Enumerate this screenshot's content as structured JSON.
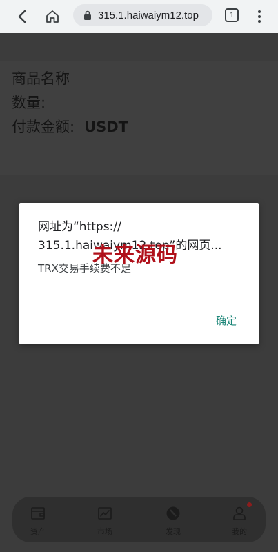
{
  "browser": {
    "url": "315.1.haiwaiym12.top",
    "tab_count": "1",
    "icons": [
      "back-arrow-icon",
      "home-icon",
      "lock-icon",
      "more-vert-icon"
    ]
  },
  "order": {
    "product_label": "商品名称",
    "quantity_label": "数量:",
    "payment_label": "付款金额:",
    "currency": "USDT"
  },
  "dialog": {
    "title_line1": "网址为“https://",
    "title_line2": "315.1.haiwaiym12.top”的网页...",
    "message": "TRX交易手续费不足",
    "ok_label": "确定",
    "watermark": "未来源码",
    "accent_color": "#1a8577"
  },
  "bottom_nav": {
    "items": [
      {
        "label": "资产",
        "icon": "wallet-icon"
      },
      {
        "label": "市场",
        "icon": "chart-icon"
      },
      {
        "label": "发现",
        "icon": "discover-icon"
      },
      {
        "label": "我的",
        "icon": "user-icon"
      }
    ]
  }
}
